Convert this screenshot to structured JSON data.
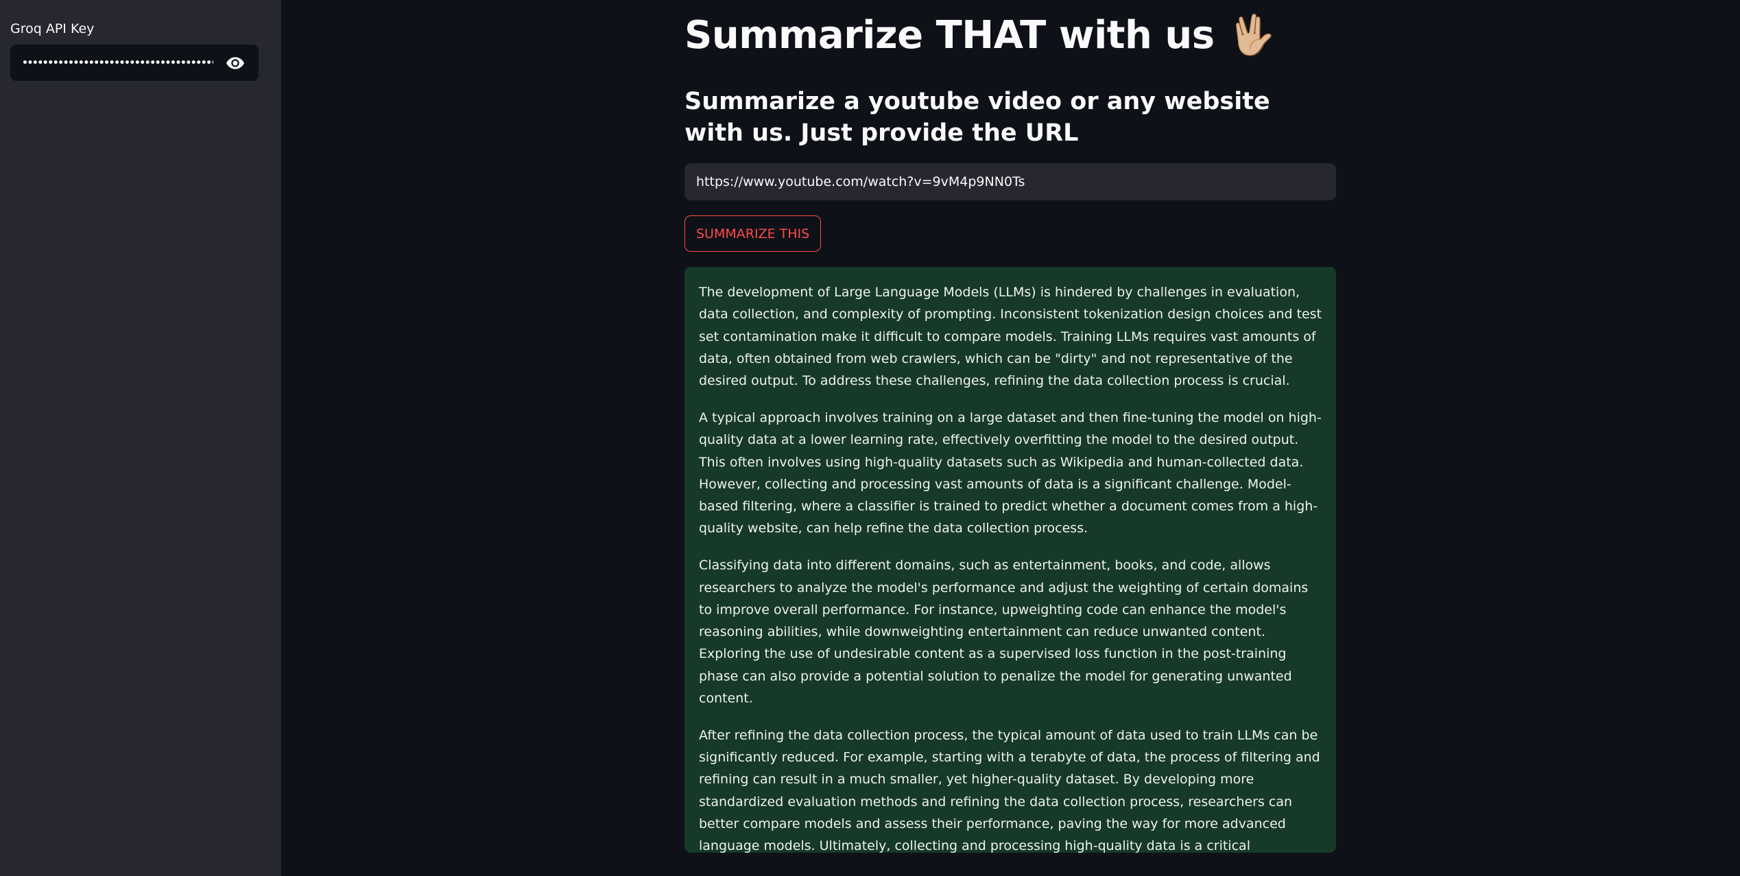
{
  "sidebar": {
    "api_key_label": "Groq API Key",
    "api_key_masked": "•••••••••••••••••••••••••••••••••••••••••••••••••••••••••"
  },
  "main": {
    "title": "Summarize THAT with us",
    "title_emoji": "🖖🏼",
    "subtitle": "Summarize a youtube video or any website with us. Just provide the URL",
    "url_value": "https://www.youtube.com/watch?v=9vM4p9NN0Ts",
    "button_label": "SUMMARIZE THIS",
    "summary_paragraphs": [
      "The development of Large Language Models (LLMs) is hindered by challenges in evaluation, data collection, and complexity of prompting. Inconsistent tokenization design choices and test set contamination make it difficult to compare models. Training LLMs requires vast amounts of data, often obtained from web crawlers, which can be \"dirty\" and not representative of the desired output. To address these challenges, refining the data collection process is crucial.",
      "A typical approach involves training on a large dataset and then fine-tuning the model on high-quality data at a lower learning rate, effectively overfitting the model to the desired output. This often involves using high-quality datasets such as Wikipedia and human-collected data. However, collecting and processing vast amounts of data is a significant challenge. Model-based filtering, where a classifier is trained to predict whether a document comes from a high-quality website, can help refine the data collection process.",
      "Classifying data into different domains, such as entertainment, books, and code, allows researchers to analyze the model's performance and adjust the weighting of certain domains to improve overall performance. For instance, upweighting code can enhance the model's reasoning abilities, while downweighting entertainment can reduce unwanted content. Exploring the use of undesirable content as a supervised loss function in the post-training phase can also provide a potential solution to penalize the model for generating unwanted content.",
      "After refining the data collection process, the typical amount of data used to train LLMs can be significantly reduced. For example, starting with a terabyte of data, the process of filtering and refining can result in a much smaller, yet higher-quality dataset. By developing more standardized evaluation methods and refining the data collection process, researchers can better compare models and assess their performance, paving the way for more advanced language models. Ultimately, collecting and processing high-quality data is a critical component of developing effective LLMs."
    ]
  },
  "icons": {
    "visibility_toggle": "eye-icon"
  },
  "colors": {
    "background": "#0e1117",
    "sidebar": "#262730",
    "accent": "#ff4b4b",
    "success_box": "#173928"
  }
}
